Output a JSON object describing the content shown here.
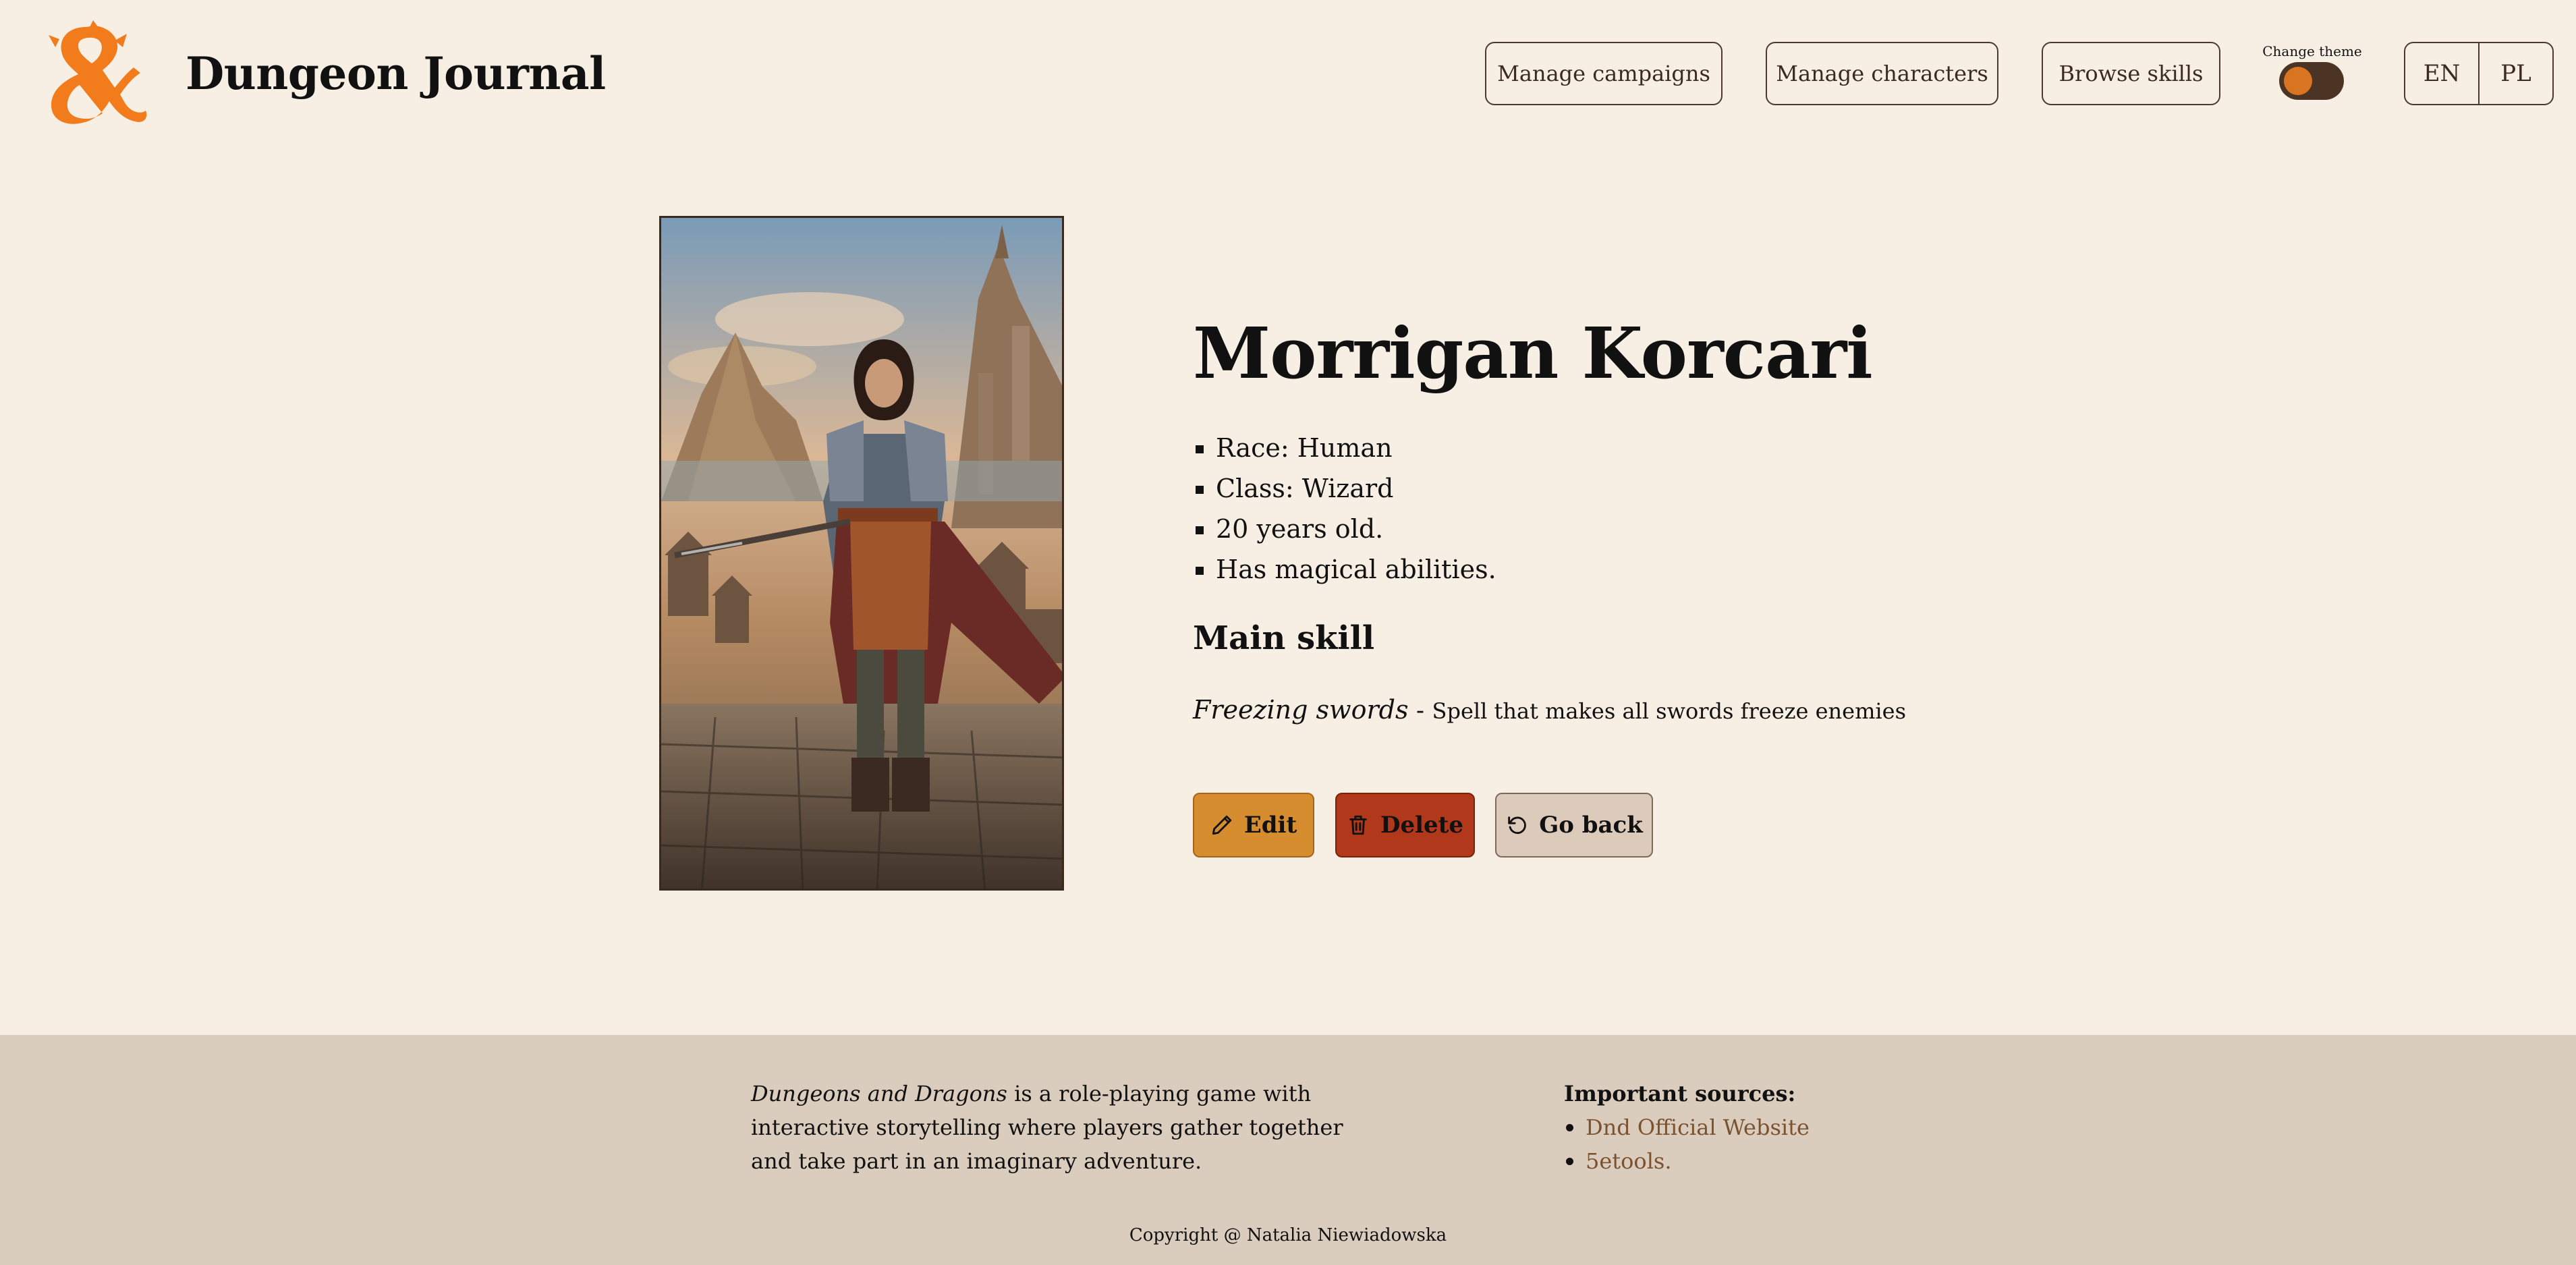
{
  "header": {
    "brand": "Dungeon Journal",
    "nav": [
      {
        "label": "Manage campaigns"
      },
      {
        "label": "Manage characters"
      },
      {
        "label": "Browse skills"
      }
    ],
    "theme_label": "Change theme",
    "languages": [
      "EN",
      "PL"
    ]
  },
  "character": {
    "name": "Morrigan Korcari",
    "facts": [
      "Race: Human",
      "Class: Wizard",
      "20 years old.",
      "Has magical abilities."
    ],
    "main_skill_heading": "Main skill",
    "skill_name": "Freezing swords",
    "skill_separator": " - ",
    "skill_description": "Spell that makes all swords freeze enemies"
  },
  "actions": {
    "edit": "Edit",
    "delete": "Delete",
    "back": "Go back"
  },
  "footer": {
    "about_em": "Dungeons and Dragons",
    "about_rest": " is a role-playing game with interactive storytelling where players gather together and take part in an imaginary adventure.",
    "sources_title": "Important sources:",
    "sources": [
      "Dnd Official Website",
      "5etools."
    ],
    "copyright": "Copyright @ Natalia Niewiadowska"
  },
  "colors": {
    "background": "#f8efe4",
    "accent_orange": "#f27b1c",
    "edit": "#d68d30",
    "delete": "#b1381a",
    "back": "#dccbbb",
    "footer": "#dbcdbd"
  },
  "icons": {
    "logo": "dnd-ampersand-logo",
    "edit": "pencil-icon",
    "delete": "trash-icon",
    "back": "rotate-ccw-icon"
  }
}
